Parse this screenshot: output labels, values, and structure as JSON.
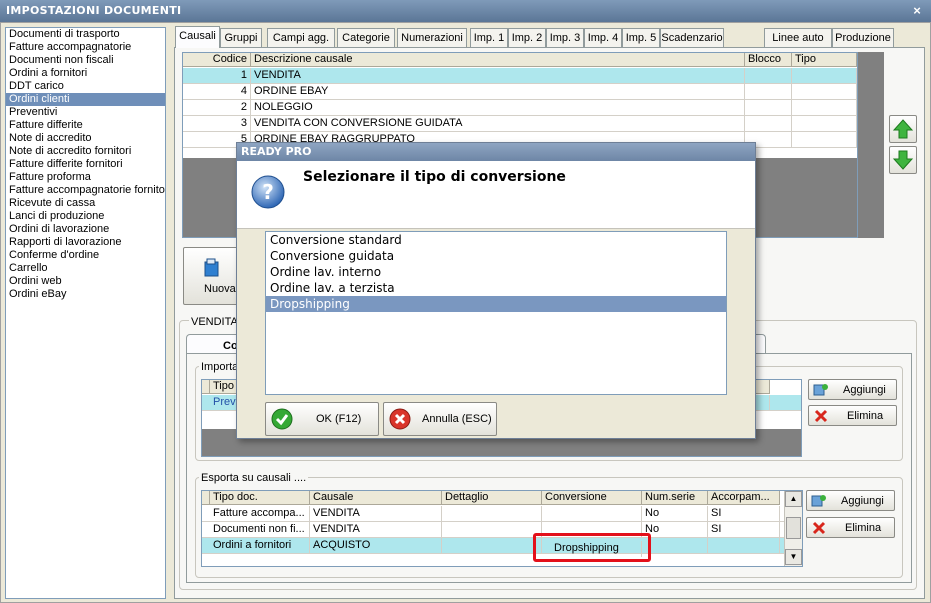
{
  "window": {
    "title": "IMPOSTAZIONI DOCUMENTI",
    "close": "×"
  },
  "sidebar": {
    "items": [
      "Documenti di trasporto",
      "Fatture accompagnatorie",
      "Documenti non fiscali",
      "Ordini a fornitori",
      "DDT carico",
      "Ordini clienti",
      "Preventivi",
      "Fatture differite",
      "Note di accredito",
      "Note di accredito fornitori",
      "Fatture differite fornitori",
      "Fatture proforma",
      "Fatture accompagnatorie fornito",
      "Ricevute di cassa",
      "Lanci di produzione",
      "Ordini di lavorazione",
      "Rapporti di lavorazione",
      "Conferme d'ordine",
      "Carrello",
      "Ordini web",
      "Ordini eBay"
    ],
    "selected_index": 5
  },
  "tabs": [
    "Causali",
    "Gruppi",
    "Campi agg.",
    "Categorie",
    "Numerazioni",
    "Imp. 1",
    "Imp. 2",
    "Imp. 3",
    "Imp. 4",
    "Imp. 5",
    "Scadenzario",
    "Linee auto",
    "Produzione"
  ],
  "causali_grid": {
    "headers": [
      "Codice",
      "Descrizione causale",
      "Blocco",
      "Tipo"
    ],
    "rows": [
      {
        "codice": "1",
        "descrizione": "VENDITA"
      },
      {
        "codice": "4",
        "descrizione": "ORDINE EBAY"
      },
      {
        "codice": "2",
        "descrizione": "NOLEGGIO"
      },
      {
        "codice": "3",
        "descrizione": "VENDITA CON CONVERSIONE GUIDATA"
      },
      {
        "codice": "5",
        "descrizione": "ORDINE EBAY RAGGRUPPATO"
      }
    ]
  },
  "toolbar": {
    "nuova_label": "Nuova"
  },
  "section": {
    "label": "VENDITA",
    "subtab_label": "Co"
  },
  "importa": {
    "label": "Importa",
    "headers": [
      "Tipo d"
    ],
    "rows": [
      "Preve"
    ]
  },
  "importa_buttons": {
    "add": "Aggiungi",
    "delete": "Elimina"
  },
  "esporta": {
    "label": "Esporta su causali ....",
    "headers": [
      "Tipo doc.",
      "Causale",
      "Dettaglio",
      "Conversione",
      "Num.serie",
      "Accorpam..."
    ],
    "rows": [
      {
        "tipo": "Fatture accompa...",
        "causale": "VENDITA",
        "dettaglio": "",
        "conversione": "",
        "numserie": "No",
        "accorpam": "SI"
      },
      {
        "tipo": "Documenti non fi...",
        "causale": "VENDITA",
        "dettaglio": "",
        "conversione": "",
        "numserie": "No",
        "accorpam": "SI"
      },
      {
        "tipo": "Ordini a fornitori",
        "causale": "ACQUISTO",
        "dettaglio": "",
        "conversione": "Dropshipping",
        "numserie": "",
        "accorpam": ""
      }
    ]
  },
  "esporta_buttons": {
    "add": "Aggiungi",
    "delete": "Elimina"
  },
  "dialog": {
    "title": "READY PRO",
    "heading": "Selezionare il tipo di conversione",
    "options": [
      "Conversione standard",
      "Conversione guidata",
      "Ordine lav. interno",
      "Ordine lav. a terzista",
      "Dropshipping"
    ],
    "selected_index": 4,
    "ok_label": "OK (F12)",
    "cancel_label": "Annulla (ESC)"
  },
  "colors": {
    "selection": "#aee7ed",
    "highlight": "#e3101a",
    "dialog_selection": "#7a97c0"
  }
}
